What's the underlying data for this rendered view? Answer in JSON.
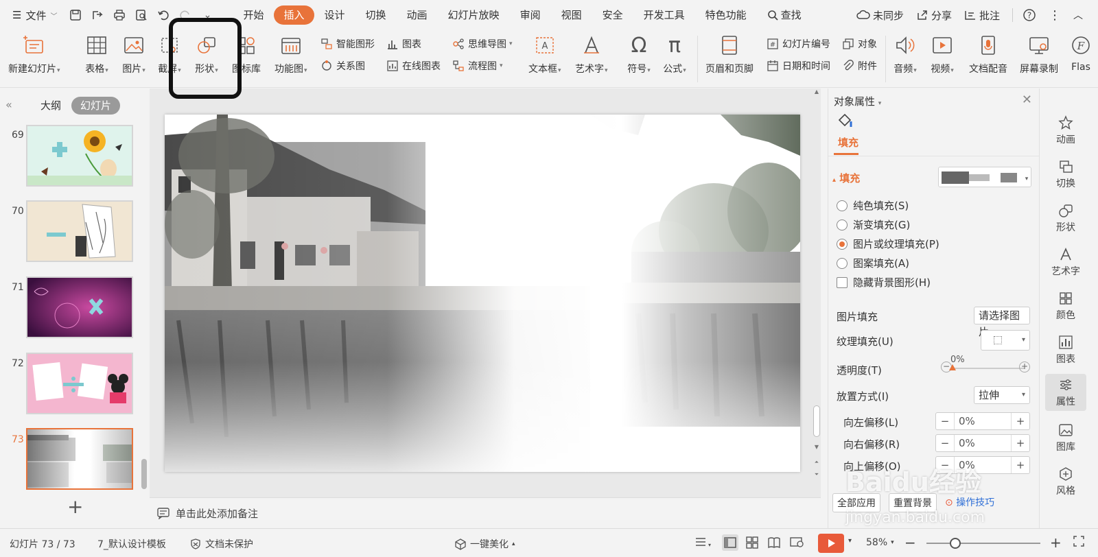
{
  "menubar": {
    "file_label": "文件",
    "tabs": [
      "开始",
      "插入",
      "设计",
      "切换",
      "动画",
      "幻灯片放映",
      "审阅",
      "视图",
      "安全",
      "开发工具",
      "特色功能"
    ],
    "active_tab": "插入",
    "search_label": "查找",
    "sync_label": "未同步",
    "share_label": "分享",
    "comment_label": "批注"
  },
  "ribbon": {
    "new_slide": "新建幻灯片",
    "table": "表格",
    "picture": "图片",
    "screenshot": "截屏",
    "shape": "形状",
    "icon_library": "图标库",
    "function_chart": "功能图",
    "smart_graphic": "智能图形",
    "chart": "图表",
    "relation_chart": "关系图",
    "online_chart": "在线图表",
    "mind_map": "思维导图",
    "flowchart": "流程图",
    "textbox": "文本框",
    "wordart": "艺术字",
    "symbol": "符号",
    "formula": "公式",
    "header_footer": "页眉和页脚",
    "slide_number": "幻灯片编号",
    "object": "对象",
    "datetime": "日期和时间",
    "attachment": "附件",
    "audio": "音频",
    "video": "视频",
    "doc_voice": "文档配音",
    "screen_record": "屏幕录制",
    "flash": "Flas"
  },
  "left_panel": {
    "tab_outline": "大纲",
    "tab_slides": "幻灯片",
    "thumbnails": [
      {
        "num": "69"
      },
      {
        "num": "70"
      },
      {
        "num": "71"
      },
      {
        "num": "72"
      },
      {
        "num": "73"
      }
    ],
    "add_label": "+"
  },
  "canvas": {
    "notes_placeholder": "单击此处添加备注"
  },
  "right_panel": {
    "title": "对象属性",
    "fill_tab": "填充",
    "section_fill": "填充",
    "radio_solid": "纯色填充(S)",
    "radio_gradient": "渐变填充(G)",
    "radio_picture": "图片或纹理填充(P)",
    "radio_pattern": "图案填充(A)",
    "checkbox_hide_bg": "隐藏背景图形(H)",
    "picture_fill_label": "图片填充",
    "picture_fill_button": "请选择图片",
    "texture_fill_label": "纹理填充(U)",
    "transparency_label": "透明度(T)",
    "transparency_value": "0%",
    "placement_label": "放置方式(I)",
    "placement_value": "拉伸",
    "offset_left_label": "向左偏移(L)",
    "offset_left_value": "0%",
    "offset_right_label": "向右偏移(R)",
    "offset_right_value": "0%",
    "offset_up_label": "向上偏移(O)",
    "offset_up_value": "0%",
    "apply_all": "全部应用",
    "reset_bg": "重置背景",
    "tips": "操作技巧"
  },
  "right_bar": {
    "items": [
      "动画",
      "切换",
      "形状",
      "艺术字",
      "颜色",
      "图表",
      "属性",
      "图库",
      "风格"
    ],
    "active": "属性"
  },
  "statusbar": {
    "slide_count": "幻灯片 73 / 73",
    "template": "7_默认设计模板",
    "protect": "文档未保护",
    "beautify": "一键美化",
    "zoom": "58%"
  },
  "watermark": {
    "text": "Baidu经验",
    "url": "jingyan.baidu.com"
  },
  "colors": {
    "accent": "#e8733a",
    "play": "#e85a3a",
    "link": "#2f6fd6"
  }
}
